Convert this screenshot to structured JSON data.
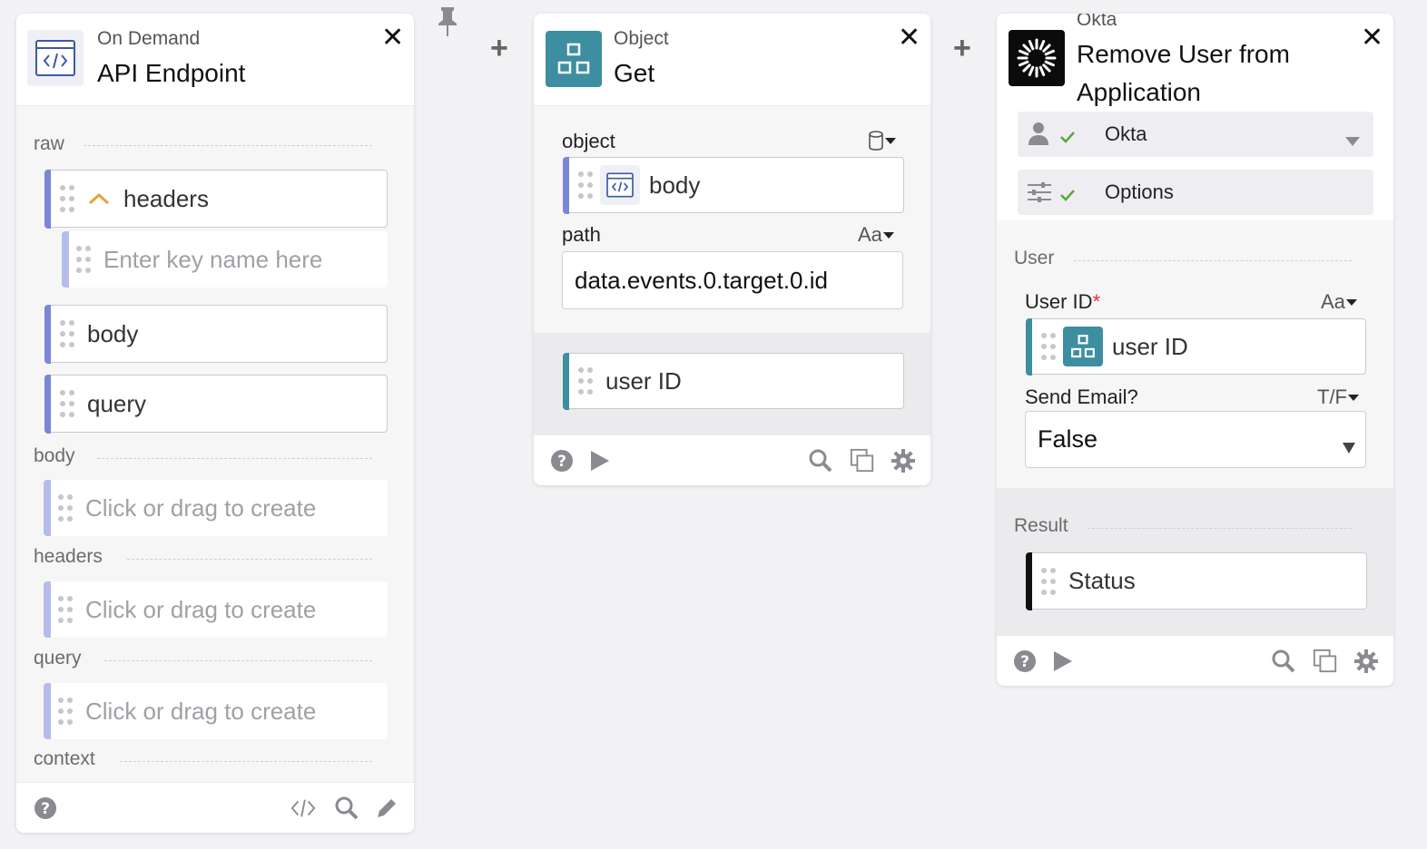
{
  "card1": {
    "subtitle": "On Demand",
    "title": "API Endpoint",
    "sections": {
      "raw": "raw",
      "body": "body",
      "headers": "headers",
      "query": "query",
      "context": "context"
    },
    "raw_items": {
      "headers": "headers",
      "key_placeholder": "Enter key name here",
      "body": "body",
      "query": "query"
    },
    "placeholder": "Click or drag to create"
  },
  "card2": {
    "subtitle": "Object",
    "title": "Get",
    "object_label": "object",
    "object_chip": "body",
    "path_label": "path",
    "path_type": "Aa",
    "path_value": "data.events.0.target.0.id",
    "output_chip": "user ID"
  },
  "card3": {
    "subtitle": "Okta",
    "title_line1": "Remove User from",
    "title_line2": "Application",
    "connection": "Okta",
    "options": "Options",
    "user_section": "User",
    "user_id_label": "User ID",
    "required_mark": "*",
    "user_id_type": "Aa",
    "user_id_chip": "user ID",
    "send_email_label": "Send Email?",
    "send_email_type": "T/F",
    "send_email_value": "False",
    "result_section": "Result",
    "result_chip": "Status"
  },
  "colors": {
    "accent_blue": "#7b86d6",
    "object_teal": "#3d8ea0",
    "connector_check": "#5aa83a",
    "chevron_orange": "#e0a63a",
    "required_red": "#d33"
  },
  "icons": [
    "api-endpoint-icon",
    "object-icon",
    "okta-logo-icon",
    "pin-icon",
    "plus-icon",
    "close-icon",
    "help-icon",
    "play-icon",
    "search-icon",
    "copy-icon",
    "gear-icon",
    "code-icon",
    "pencil-icon",
    "database-icon",
    "user-icon",
    "check-icon",
    "sliders-icon",
    "dropdown-caret-icon",
    "drag-grip-icon"
  ]
}
